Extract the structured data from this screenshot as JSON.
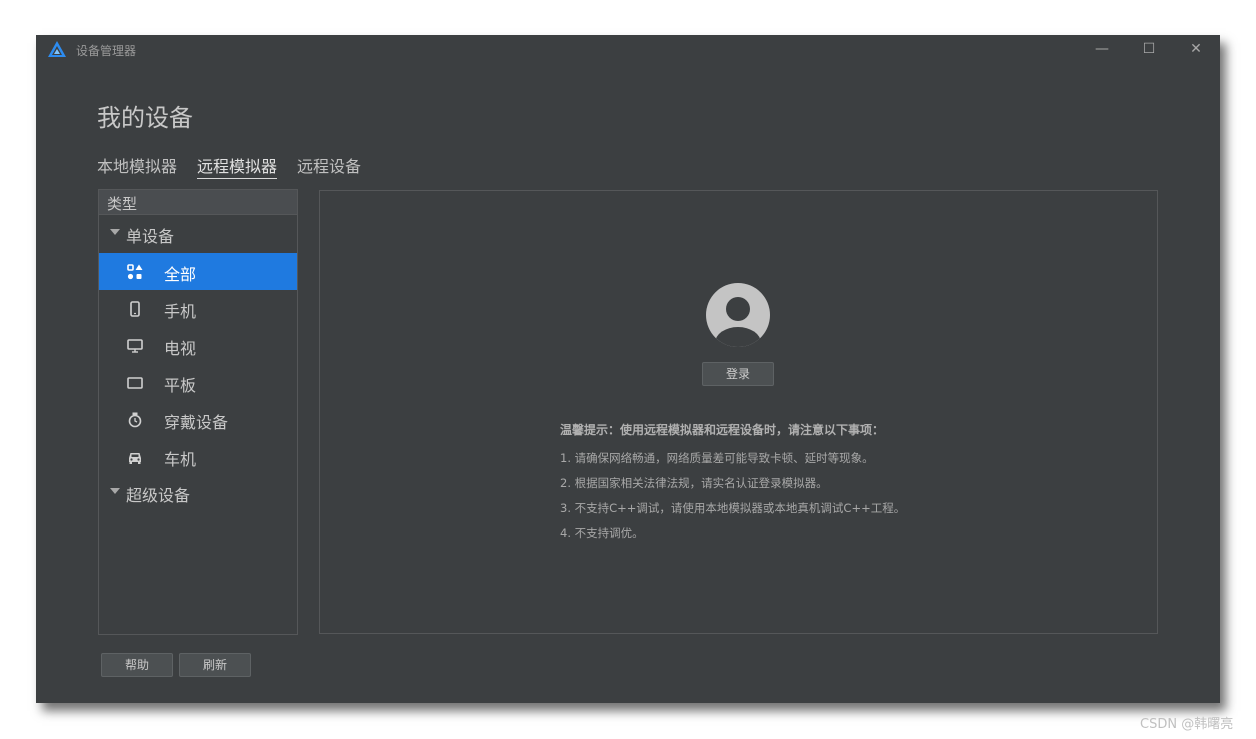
{
  "window": {
    "title": "设备管理器",
    "controls": [
      "—",
      "☐",
      "✕"
    ]
  },
  "page_title": "我的设备",
  "tabs": [
    {
      "label": "本地模拟器",
      "active": false
    },
    {
      "label": "远程模拟器",
      "active": true
    },
    {
      "label": "远程设备",
      "active": false
    }
  ],
  "sidebar": {
    "header": "类型",
    "groups": [
      {
        "label": "单设备",
        "expanded": true
      },
      {
        "label": "超级设备",
        "expanded": true
      }
    ],
    "items": [
      {
        "label": "全部",
        "icon": "grid-shapes-icon",
        "selected": true
      },
      {
        "label": "手机",
        "icon": "phone-icon",
        "selected": false
      },
      {
        "label": "电视",
        "icon": "tv-icon",
        "selected": false
      },
      {
        "label": "平板",
        "icon": "tablet-icon",
        "selected": false
      },
      {
        "label": "穿戴设备",
        "icon": "watch-icon",
        "selected": false
      },
      {
        "label": "车机",
        "icon": "car-icon",
        "selected": false
      }
    ]
  },
  "main": {
    "login_label": "登录",
    "notice_title": "温馨提示：使用远程模拟器和远程设备时，请注意以下事项：",
    "notice_lines": [
      "1. 请确保网络畅通，网络质量差可能导致卡顿、延时等现象。",
      "2. 根据国家相关法律法规，请实名认证登录模拟器。",
      "3. 不支持C++调试，请使用本地模拟器或本地真机调试C++工程。",
      "4. 不支持调优。"
    ]
  },
  "footer": {
    "help_label": "帮助",
    "refresh_label": "刷新"
  },
  "watermark": "CSDN @韩曙亮",
  "colors": {
    "accent": "#1f7ae0",
    "background": "#3c3f41",
    "border": "#555759"
  }
}
